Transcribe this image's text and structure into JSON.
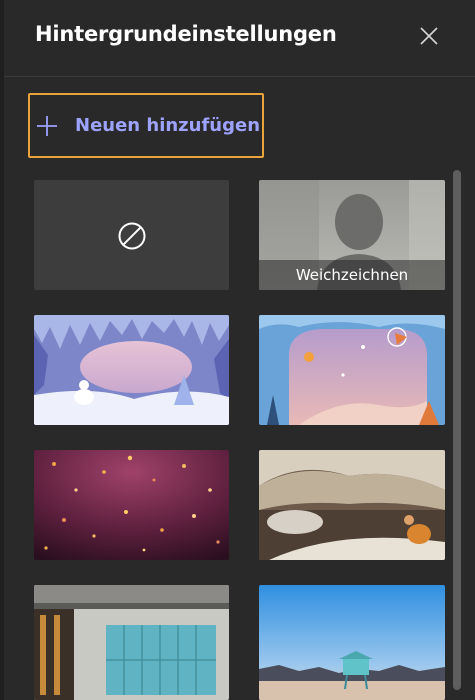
{
  "header": {
    "title": "Hintergrundeinstellungen",
    "close_icon": "close-icon"
  },
  "add_button": {
    "label": "Neuen hinzufügen",
    "icon": "plus-icon"
  },
  "backgrounds": {
    "none": {
      "icon": "no-background-icon"
    },
    "blur": {
      "label": "Weichzeichnen"
    },
    "images": [
      "ice-cave",
      "winter-scene",
      "confetti",
      "blanket-fort",
      "office",
      "beach-lifeguard"
    ]
  },
  "colors": {
    "accent": "#e8a33b",
    "link": "#9ea2ff",
    "panel": "#292929"
  }
}
